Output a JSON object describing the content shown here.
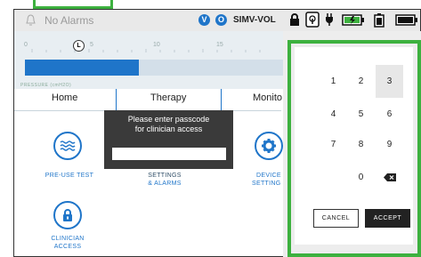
{
  "status": {
    "alarm_text": "No Alarms",
    "badge_v": "V",
    "badge_o": "O",
    "mode": "SIMV-VOL"
  },
  "pressure": {
    "ticks": [
      "0",
      "5",
      "10",
      "15"
    ],
    "marker": "L",
    "label": "PRESSURE (cmH2O)",
    "fill_fraction": 0.44
  },
  "tabs": [
    "Home",
    "Therapy",
    "Monito"
  ],
  "dialog": {
    "line1": "Please enter passcode",
    "line2": "for clinician access",
    "input_value": ""
  },
  "icons": {
    "pre_use_test": "PRE-USE TEST",
    "settings_line1": "SETTINGS",
    "settings_line2": "& ALARMS",
    "device_line1": "DEVICE",
    "device_line2": "SETTING",
    "clinician_line1": "CLINICIAN",
    "clinician_line2": "ACCESS"
  },
  "keypad": {
    "rows": [
      [
        "1",
        "2",
        "3"
      ],
      [
        "4",
        "5",
        "6"
      ],
      [
        "7",
        "8",
        "9"
      ],
      [
        "",
        "0",
        "⌫"
      ]
    ],
    "cancel": "CANCEL",
    "accept": "ACCEPT"
  },
  "colors": {
    "accent": "#1f75c9",
    "highlight": "#3db13f"
  }
}
